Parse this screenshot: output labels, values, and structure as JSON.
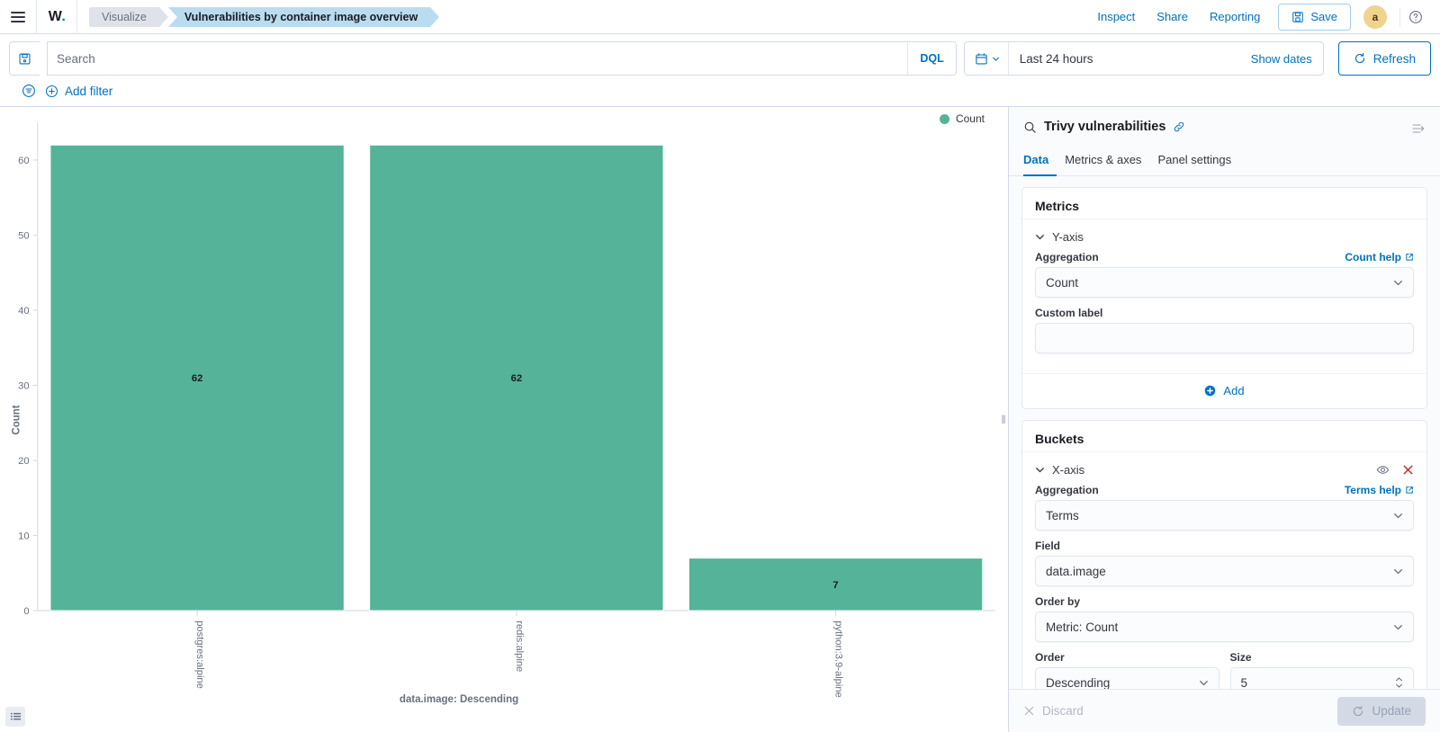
{
  "header": {
    "menu_icon": "hamburger-menu-icon",
    "logo_text": "W",
    "logo_dot": ".",
    "breadcrumbs": [
      {
        "label": "Visualize",
        "active": false
      },
      {
        "label": "Vulnerabilities by container image overview",
        "active": true
      }
    ],
    "links": [
      "Inspect",
      "Share",
      "Reporting"
    ],
    "save_label": "Save",
    "avatar_initial": "a",
    "help_icon": "question-circle-icon"
  },
  "query_bar": {
    "saved_query_icon": "save-disk-icon",
    "search_placeholder": "Search",
    "search_value": "",
    "language_badge": "DQL",
    "calendar_icon": "calendar-icon",
    "date_range": "Last 24 hours",
    "show_dates_label": "Show dates",
    "refresh_label": "Refresh"
  },
  "filter_bar": {
    "filter_icon": "filter-list-icon",
    "add_filter_label": "Add filter"
  },
  "chart_data": {
    "type": "bar",
    "title": "",
    "categories": [
      "postgres:alpine",
      "redis:alpine",
      "python:3.9-alpine"
    ],
    "values": [
      62,
      62,
      7
    ],
    "data_labels": [
      "62",
      "62",
      "7"
    ],
    "xlabel": "data.image: Descending",
    "ylabel": "Count",
    "ylim": [
      0,
      65
    ],
    "yticks": [
      0,
      10,
      20,
      30,
      40,
      50,
      60
    ],
    "ytick_labels": [
      "0",
      "10",
      "20",
      "30",
      "40",
      "50",
      "60"
    ],
    "grid": false,
    "legend": {
      "position": "top-right",
      "entries": [
        "Count"
      ]
    },
    "series_color": "#54b399"
  },
  "viz_pane": {
    "table_toggle_icon": "data-table-icon"
  },
  "editor": {
    "search_icon": "magnifier-icon",
    "title": "Trivy vulnerabilities",
    "link_icon": "link-chain-icon",
    "collapse_icon": "collapse-panel-icon",
    "tabs": [
      {
        "label": "Data",
        "active": true
      },
      {
        "label": "Metrics & axes",
        "active": false
      },
      {
        "label": "Panel settings",
        "active": false
      }
    ],
    "metrics": {
      "panel_title": "Metrics",
      "agg_name": "Y-axis",
      "aggregation_label": "Aggregation",
      "aggregation_help": "Count help",
      "aggregation_value": "Count",
      "custom_label_label": "Custom label",
      "custom_label_value": "",
      "add_label": "Add"
    },
    "buckets": {
      "panel_title": "Buckets",
      "agg_name": "X-axis",
      "visibility_icon": "eye-icon",
      "remove_icon": "close-x-icon",
      "aggregation_label": "Aggregation",
      "aggregation_help": "Terms help",
      "aggregation_value": "Terms",
      "field_label": "Field",
      "field_value": "data.image",
      "order_by_label": "Order by",
      "order_by_value": "Metric: Count",
      "order_label": "Order",
      "order_value": "Descending",
      "size_label": "Size",
      "size_value": "5"
    },
    "footer": {
      "discard_label": "Discard",
      "update_label": "Update"
    }
  },
  "colors": {
    "accent": "#0071c2",
    "bar": "#54b399",
    "breadcrumb_active": "#b9dcf0",
    "avatar": "#f0d48d"
  }
}
